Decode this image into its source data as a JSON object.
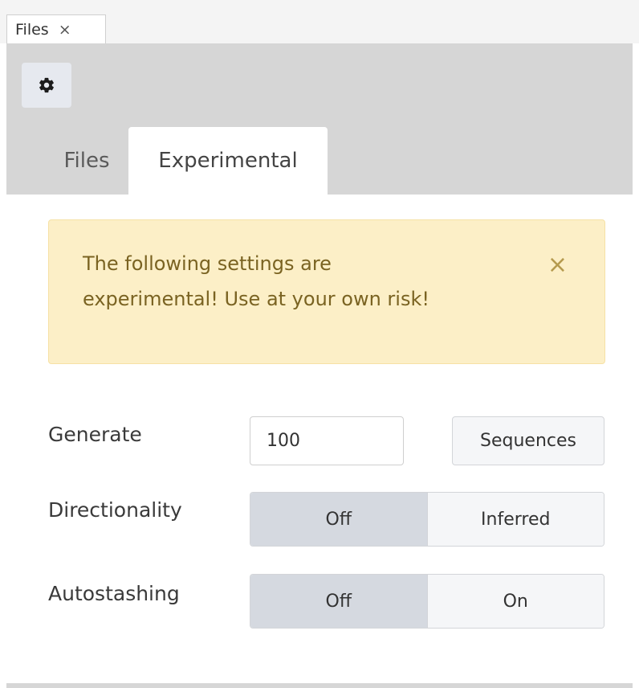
{
  "window_tab": {
    "label": "Files",
    "close_glyph": "×"
  },
  "panel": {
    "settings_icon": "gear-icon",
    "tabs": [
      {
        "label": "Files",
        "active": false
      },
      {
        "label": "Experimental",
        "active": true
      }
    ]
  },
  "alert": {
    "line1": "The following settings are",
    "line2": "experimental! Use at your own risk!",
    "close_glyph": "×"
  },
  "settings": {
    "generate": {
      "label": "Generate",
      "value": "100",
      "button_label": "Sequences"
    },
    "directionality": {
      "label": "Directionality",
      "options": [
        "Off",
        "Inferred"
      ],
      "selected": "Off"
    },
    "autostashing": {
      "label": "Autostashing",
      "options": [
        "Off",
        "On"
      ],
      "selected": "Off"
    }
  },
  "colors": {
    "panel_bg": "#d6d6d6",
    "alert_bg": "#fcefc7",
    "alert_text": "#7a6322",
    "segment_active": "#d5d9e0"
  }
}
